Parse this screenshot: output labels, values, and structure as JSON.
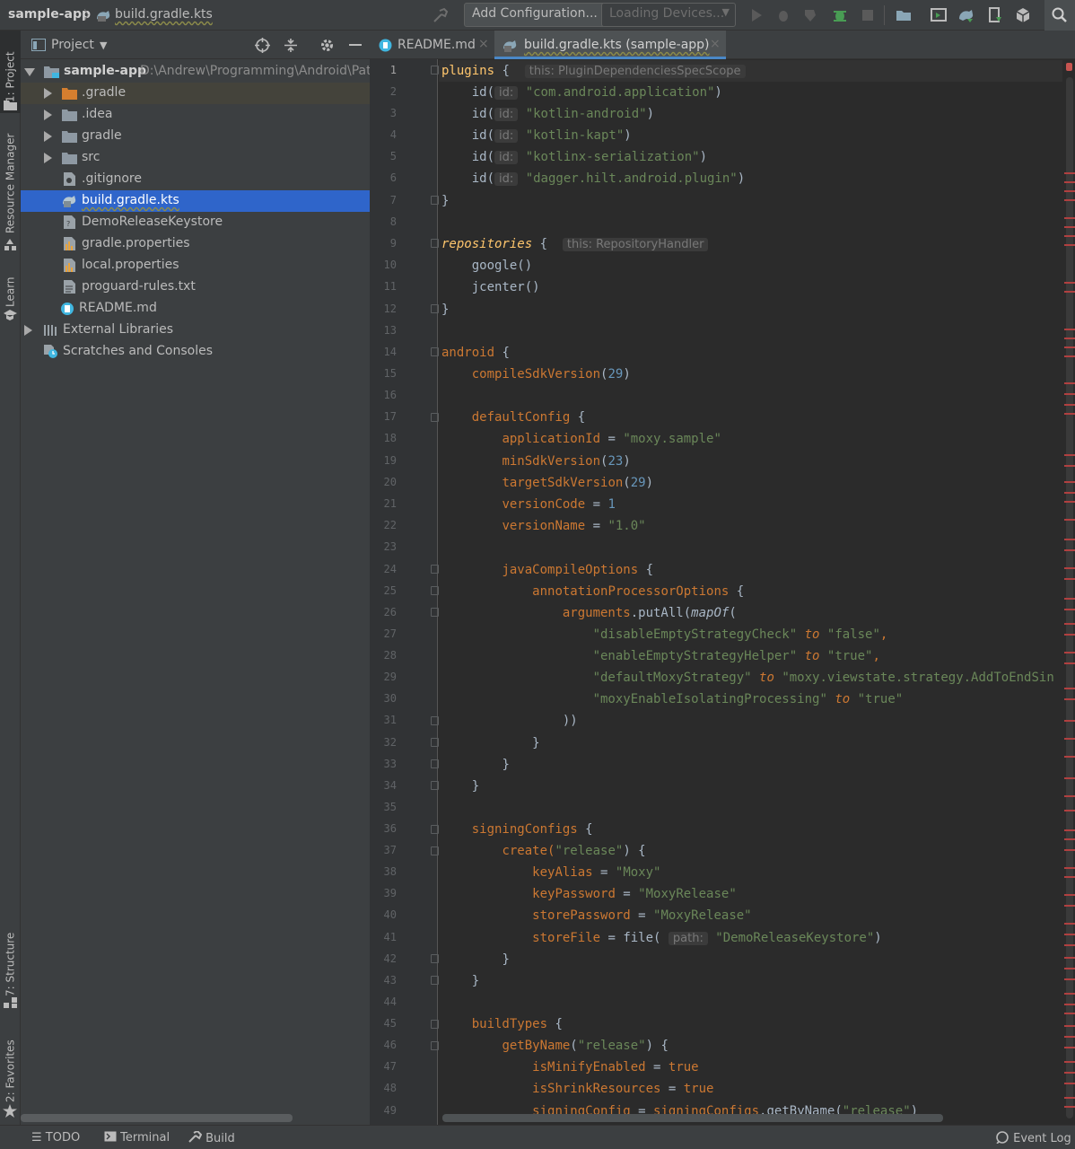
{
  "navbar": {
    "project_name": "sample-app",
    "file_name": "build.gradle.kts",
    "add_config_label": "Add Configuration...",
    "devices_label": "Loading Devices..."
  },
  "left_stripe": {
    "project_tab": "1: Project",
    "resource_manager_tab": "Resource Manager",
    "learn_tab": "Learn",
    "structure_tab": "7: Structure",
    "favorites_tab": "2: Favorites"
  },
  "project_panel": {
    "view_label": "Project",
    "tree": [
      {
        "label": "sample-app",
        "path": "D:\\Andrew\\Programming\\Android\\Patte",
        "icon": "module-folder-icon",
        "expanded": true
      },
      {
        "label": ".gradle",
        "icon": "folder-orange-icon"
      },
      {
        "label": ".idea",
        "icon": "folder-icon"
      },
      {
        "label": "gradle",
        "icon": "folder-icon"
      },
      {
        "label": "src",
        "icon": "folder-icon"
      },
      {
        "label": ".gitignore",
        "icon": "gitignore-file-icon"
      },
      {
        "label": "build.gradle.kts",
        "icon": "gradle-kts-file-icon",
        "selected": true
      },
      {
        "label": "DemoReleaseKeystore",
        "icon": "keystore-file-icon"
      },
      {
        "label": "gradle.properties",
        "icon": "properties-file-icon"
      },
      {
        "label": "local.properties",
        "icon": "properties-file-icon"
      },
      {
        "label": "proguard-rules.txt",
        "icon": "text-file-icon"
      },
      {
        "label": "README.md",
        "icon": "markdown-file-icon"
      },
      {
        "label": "External Libraries",
        "icon": "libraries-icon"
      },
      {
        "label": "Scratches and Consoles",
        "icon": "scratches-icon"
      }
    ]
  },
  "editor_tabs": [
    {
      "label": "README.md",
      "active": false
    },
    {
      "label": "build.gradle.kts (sample-app)",
      "active": true
    }
  ],
  "hints": {
    "plugins": "this: PluginDependenciesSpecScope",
    "id": "id:",
    "repositories": "this: RepositoryHandler",
    "path": "path:"
  },
  "code": {
    "l1_plugins": "plugins",
    "l1_open": " {",
    "s_app": "\"com.android.application\"",
    "s_kotlin_android": "\"kotlin-android\"",
    "s_kapt": "\"kotlin-kapt\"",
    "s_serial": "\"kotlinx-serialization\"",
    "s_hilt": "\"dagger.hilt.android.plugin\"",
    "id_open": "id(",
    "paren_close": ")",
    "brace_close": "}",
    "repositories": "repositories",
    "google": "google()",
    "jcenter": "jcenter()",
    "android": "android",
    "compileSdkVersion": "compileSdkVersion",
    "n29": "29",
    "defaultConfig": "defaultConfig",
    "applicationId": "applicationId",
    "s_moxy_sample": "\"moxy.sample\"",
    "minSdkVersion": "minSdkVersion",
    "n23": "23",
    "targetSdkVersion": "targetSdkVersion",
    "versionCode": "versionCode",
    "n1": "1",
    "versionName": "versionName",
    "s_v10": "\"1.0\"",
    "javaCompileOptions": "javaCompileOptions",
    "annotationProcessorOptions": "annotationProcessorOptions",
    "arguments": "arguments",
    "putAll": ".putAll(",
    "mapOf": "mapOf",
    "s_disable": "\"disableEmptyStrategyCheck\"",
    "to": "to",
    "s_false": "\"false\"",
    "s_enable": "\"enableEmptyStrategyHelper\"",
    "s_true": "\"true\"",
    "s_default": "\"defaultMoxyStrategy\"",
    "s_addtoend": "\"moxy.viewstate.strategy.AddToEndSin",
    "s_isolating": "\"moxyEnableIsolatingProcessing\"",
    "dbl_close": "))",
    "signingConfigs": "signingConfigs",
    "create": "create(",
    "s_release": "\"release\"",
    "keyAlias": "keyAlias",
    "s_moxy": "\"Moxy\"",
    "keyPassword": "keyPassword",
    "s_moxyrelease": "\"MoxyRelease\"",
    "storePassword": "storePassword",
    "storeFile": "storeFile",
    "file_open": "file(",
    "s_keystore": "\"DemoReleaseKeystore\"",
    "buildTypes": "buildTypes",
    "getByName": "getByName",
    "isMinifyEnabled": "isMinifyEnabled",
    "kw_true": "true",
    "isShrinkResources": "isShrinkResources",
    "signingConfig": "signingConfig",
    "getByName_call": ".getByName(",
    "eq": " = ",
    "comma": ","
  },
  "line_numbers": [
    "1",
    "2",
    "3",
    "4",
    "5",
    "6",
    "7",
    "8",
    "9",
    "10",
    "11",
    "12",
    "13",
    "14",
    "15",
    "16",
    "17",
    "18",
    "19",
    "20",
    "21",
    "22",
    "23",
    "24",
    "25",
    "26",
    "27",
    "28",
    "29",
    "30",
    "31",
    "32",
    "33",
    "34",
    "35",
    "36",
    "37",
    "38",
    "39",
    "40",
    "41",
    "42",
    "43",
    "44",
    "45",
    "46",
    "47",
    "48",
    "49"
  ],
  "bottom_bar": {
    "todo": "TODO",
    "terminal": "Terminal",
    "build": "Build",
    "event_log": "Event Log"
  },
  "colors": {
    "selection": "#2f65ca",
    "keyword": "#cc7832",
    "string": "#6a8759",
    "number": "#6897bb",
    "property": "#9876aa"
  }
}
